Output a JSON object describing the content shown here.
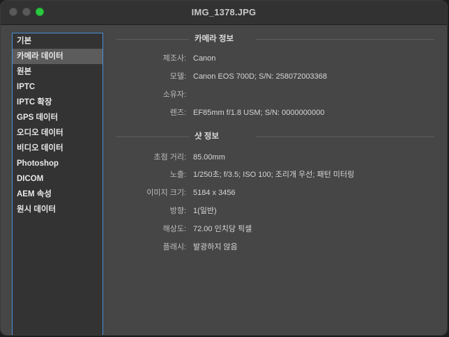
{
  "window": {
    "title": "IMG_1378.JPG"
  },
  "sidebar": {
    "items": [
      {
        "label": "기본",
        "selected": false
      },
      {
        "label": "카메라 데이터",
        "selected": true
      },
      {
        "label": "원본",
        "selected": false
      },
      {
        "label": "IPTC",
        "selected": false
      },
      {
        "label": "IPTC 확장",
        "selected": false
      },
      {
        "label": "GPS 데이터",
        "selected": false
      },
      {
        "label": "오디오 데이터",
        "selected": false
      },
      {
        "label": "비디오 데이터",
        "selected": false
      },
      {
        "label": "Photoshop",
        "selected": false
      },
      {
        "label": "DICOM",
        "selected": false
      },
      {
        "label": "AEM 속성",
        "selected": false
      },
      {
        "label": "원시 데이터",
        "selected": false
      }
    ]
  },
  "camera_info": {
    "heading": "카메라 정보",
    "rows": [
      {
        "key": "제조사:",
        "value": "Canon"
      },
      {
        "key": "모델:",
        "value": "Canon EOS 700D;   S/N: 258072003368"
      },
      {
        "key": "소유자:",
        "value": ""
      },
      {
        "key": "렌즈:",
        "value": "EF85mm f/1.8 USM;   S/N: 0000000000"
      }
    ]
  },
  "shot_info": {
    "heading": "샷 정보",
    "rows": [
      {
        "key": "초점 거리:",
        "value": "85.00mm"
      },
      {
        "key": "노출:",
        "value": "1/250초;   f/3.5;   ISO 100;   조리개 우선;   패턴 미터링"
      },
      {
        "key": "이미지 크기:",
        "value": "5184 x 3456"
      },
      {
        "key": "방향:",
        "value": "1(일반)"
      },
      {
        "key": "해상도:",
        "value": "72.00 인치당 픽셀"
      },
      {
        "key": "플래시:",
        "value": "발광하지 않음"
      }
    ]
  },
  "colors": {
    "accent": "#4a8fd6",
    "maximize": "#2ac840"
  }
}
